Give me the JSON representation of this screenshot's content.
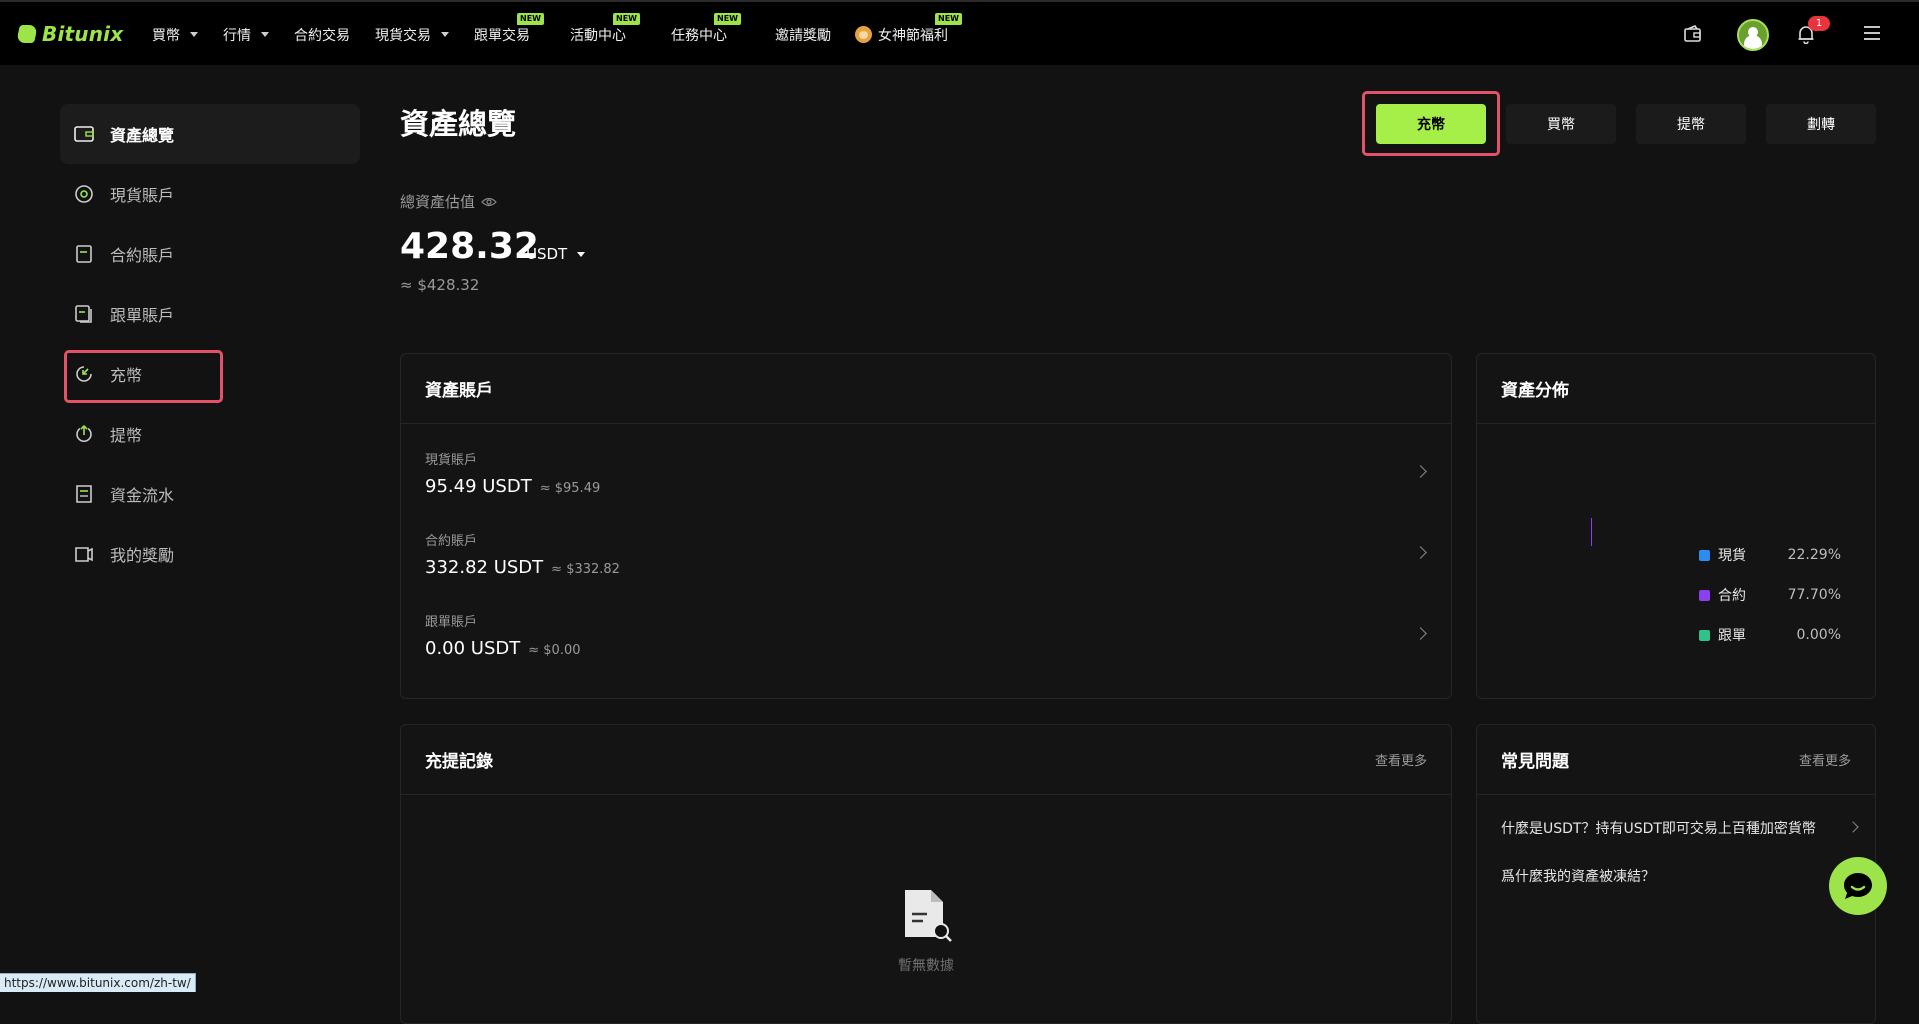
{
  "brand": {
    "name": "Bitunix",
    "accent": "#9de44a"
  },
  "nav": {
    "items": [
      {
        "label": "買幣",
        "caret": true,
        "new": false
      },
      {
        "label": "行情",
        "caret": true,
        "new": false
      },
      {
        "label": "合約交易",
        "caret": false,
        "new": false
      },
      {
        "label": "現貨交易",
        "caret": true,
        "new": false
      },
      {
        "label": "跟單交易",
        "caret": false,
        "new": true
      },
      {
        "label": "活動中心",
        "caret": false,
        "new": true
      },
      {
        "label": "任務中心",
        "caret": false,
        "new": true
      },
      {
        "label": "邀請獎勵",
        "caret": false,
        "new": false
      },
      {
        "label": "女神節福利",
        "caret": false,
        "new": true
      }
    ],
    "new_label": "NEW",
    "notification_count": "1"
  },
  "sidebar": {
    "items": [
      {
        "label": "資產總覽",
        "icon": "wallet-icon"
      },
      {
        "label": "現貨賬戶",
        "icon": "spot-icon"
      },
      {
        "label": "合約賬戶",
        "icon": "contract-icon"
      },
      {
        "label": "跟單賬戶",
        "icon": "copy-trade-icon"
      },
      {
        "label": "充幣",
        "icon": "deposit-icon"
      },
      {
        "label": "提幣",
        "icon": "withdraw-icon"
      },
      {
        "label": "資金流水",
        "icon": "ledger-icon"
      },
      {
        "label": "我的獎勵",
        "icon": "reward-icon"
      }
    ]
  },
  "overview": {
    "title": "資產總覽",
    "buttons": {
      "deposit": "充幣",
      "buy": "買幣",
      "withdraw": "提幣",
      "transfer": "劃轉"
    },
    "total_label": "總資產估值",
    "total_value": "428.32",
    "total_unit": "USDT",
    "total_usd": "≈ $428.32"
  },
  "accounts": {
    "title": "資產賬戶",
    "rows": [
      {
        "name": "現貨賬戶",
        "value": "95.49 USDT",
        "usd": "≈ $95.49"
      },
      {
        "name": "合約賬戶",
        "value": "332.82 USDT",
        "usd": "≈ $332.82"
      },
      {
        "name": "跟單賬戶",
        "value": "0.00 USDT",
        "usd": "≈ $0.00"
      }
    ]
  },
  "distribution": {
    "title": "資產分佈",
    "legend": [
      {
        "label": "現貨",
        "pct": "22.29%",
        "color": "#2d8cf0"
      },
      {
        "label": "合約",
        "pct": "77.70%",
        "color": "#8a3ff0"
      },
      {
        "label": "跟單",
        "pct": "0.00%",
        "color": "#2fc28a"
      }
    ]
  },
  "records": {
    "title": "充提記錄",
    "more": "查看更多",
    "empty": "暫無數據"
  },
  "faq": {
    "title": "常見問題",
    "more": "查看更多",
    "items": [
      "什麼是USDT？持有USDT即可交易上百種加密貨幣",
      "爲什麼我的資產被凍結？"
    ]
  },
  "status_url": "https://www.bitunix.com/zh-tw/"
}
